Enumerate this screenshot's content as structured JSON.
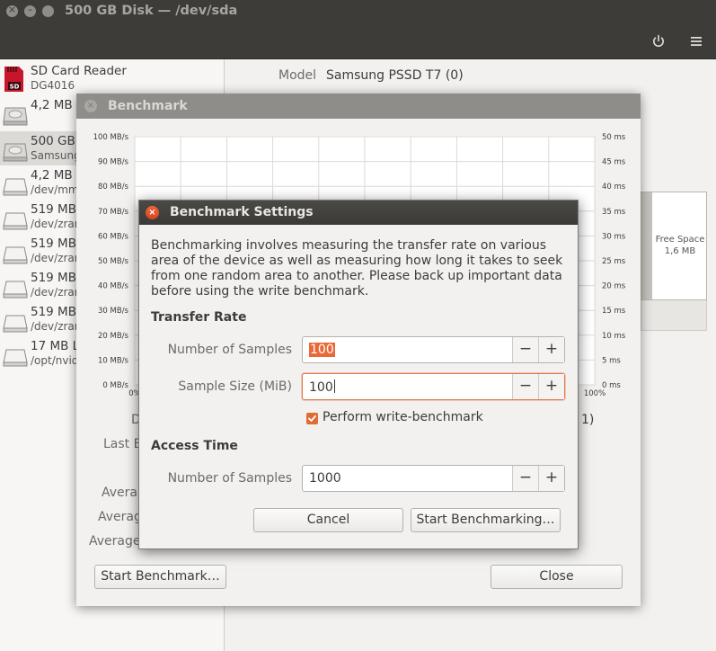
{
  "window": {
    "title": "500 GB Disk — /dev/sda",
    "close_glyph": "×",
    "min_glyph": "–"
  },
  "sidebar": {
    "drives": [
      {
        "name": "SD Card Reader",
        "sub": "DG4016",
        "icon": "sd-card-icon"
      },
      {
        "name": "4,2 MB I",
        "sub": "",
        "icon": "hard-disk-icon"
      },
      {
        "name": "500 GB I",
        "sub": "Samsung",
        "icon": "hard-disk-icon"
      },
      {
        "name": "4,2 MB I",
        "sub": "/dev/mm",
        "icon": "drive-icon"
      },
      {
        "name": "519 MB",
        "sub": "/dev/zrar",
        "icon": "drive-icon"
      },
      {
        "name": "519 MB",
        "sub": "/dev/zrar",
        "icon": "drive-icon"
      },
      {
        "name": "519 MB",
        "sub": "/dev/zrar",
        "icon": "drive-icon"
      },
      {
        "name": "519 MB",
        "sub": "/dev/zrar",
        "icon": "drive-icon"
      },
      {
        "name": "17 MB L",
        "sub": "/opt/nvid",
        "icon": "drive-icon"
      }
    ],
    "selected_index": 2
  },
  "content": {
    "model_label": "Model",
    "model_value": "Samsung PSSD T7 (0)",
    "free_space_label": "Free Space",
    "free_space_size": "1,6 MB"
  },
  "benchmark": {
    "title": "Benchmark",
    "close_glyph": "×",
    "left_axis": [
      "100 MB/s",
      "90 MB/s",
      "80 MB/s",
      "70 MB/s",
      "60 MB/s",
      "50 MB/s",
      "40 MB/s",
      "30 MB/s",
      "20 MB/s",
      "10 MB/s",
      "0 MB/s"
    ],
    "right_axis": [
      "50 ms",
      "45 ms",
      "40 ms",
      "35 ms",
      "30 ms",
      "25 ms",
      "20 ms",
      "15 ms",
      "10 ms",
      "5 ms",
      "0 ms"
    ],
    "x_start": "0%",
    "x_end": "100%",
    "side_label_d": "D",
    "side_label_1": "1)",
    "last_label": "Last B",
    "average_labels": [
      "Avera",
      "Averag",
      "Average"
    ],
    "start_button": "Start Benchmark…",
    "close_button": "Close"
  },
  "settings": {
    "title": "Benchmark Settings",
    "close_glyph": "×",
    "description": "Benchmarking involves measuring the transfer rate on various area of the device as well as measuring how long it takes to seek from one random area to another. Please back up important data before using the write benchmark.",
    "transfer_rate_heading": "Transfer Rate",
    "num_samples_label": "Number of Samples",
    "num_samples_value": "100",
    "sample_size_label": "Sample Size (MiB)",
    "sample_size_value": "100",
    "write_benchmark_label": "Perform write-benchmark",
    "write_benchmark_checked": true,
    "access_time_heading": "Access Time",
    "access_samples_label": "Number of Samples",
    "access_samples_value": "1000",
    "minus_glyph": "−",
    "plus_glyph": "+",
    "cancel_button": "Cancel",
    "start_button": "Start Benchmarking…"
  },
  "colors": {
    "accent": "#e96a37",
    "titlebar": "#3d3c38"
  }
}
